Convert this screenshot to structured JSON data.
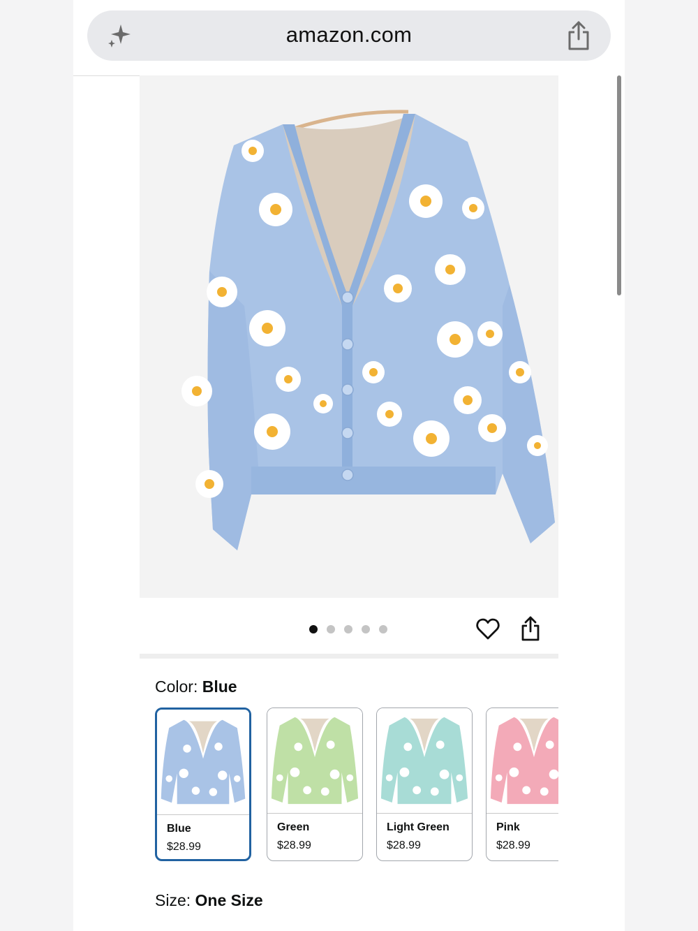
{
  "browser": {
    "url": "amazon.com"
  },
  "gallery": {
    "image_count": 5,
    "active_index": 0
  },
  "product": {
    "color_label": "Color:",
    "color_value": "Blue",
    "size_label": "Size:",
    "size_value": "One Size"
  },
  "swatches": [
    {
      "name": "Blue",
      "price": "$28.99",
      "selected": true,
      "color": "#a9c3e6"
    },
    {
      "name": "Green",
      "price": "$28.99",
      "selected": false,
      "color": "#bfe0a6"
    },
    {
      "name": "Light Green",
      "price": "$28.99",
      "selected": false,
      "color": "#a8dcd6"
    },
    {
      "name": "Pink",
      "price": "$28.99",
      "selected": false,
      "color": "#f3aab8"
    }
  ],
  "colors": {
    "selected_border": "#2162a1",
    "cardigan_blue": "#a9c3e6"
  }
}
